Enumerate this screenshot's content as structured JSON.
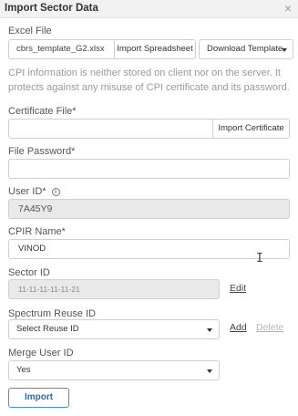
{
  "dialog": {
    "title": "Import Sector Data",
    "close_glyph": "×"
  },
  "excel": {
    "label": "Excel File",
    "file_name": "cbrs_template_G2.xlsx",
    "import_button": "Import Spreadsheet",
    "download_button": "Download Template"
  },
  "info_text": "CPI information is neither stored on client nor on the server. It protects against any misuse of CPI certificate and its password.",
  "certificate": {
    "label": "Certificate File*",
    "value": "",
    "import_button": "Import Certificate"
  },
  "password": {
    "label": "File Password*",
    "value": ""
  },
  "user_id": {
    "label": "User ID*",
    "info_glyph": "i",
    "value": "7A45Y9"
  },
  "cpir_name": {
    "label": "CPIR Name*",
    "value": "VINOD"
  },
  "sector_id": {
    "label": "Sector ID",
    "value": "11-11-11-11-11-21",
    "edit_link": "Edit"
  },
  "spectrum_reuse": {
    "label": "Spectrum Reuse ID",
    "selected": "Select Reuse ID",
    "add_link": "Add",
    "delete_link": "Delete"
  },
  "merge_user": {
    "label": "Merge User ID",
    "selected": "Yes"
  },
  "import_button": "Import",
  "icons": {
    "close": "close-icon",
    "info": "info-icon",
    "caret": "chevron-down-icon",
    "cursor": "text-cursor-icon"
  }
}
